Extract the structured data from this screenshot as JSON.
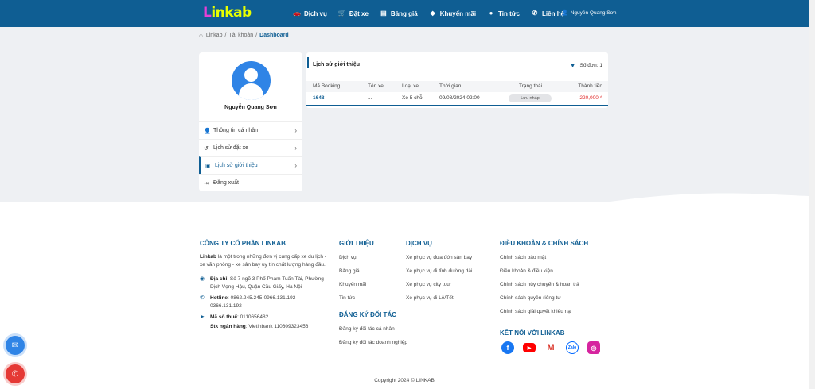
{
  "header": {
    "logo_text_1": "L",
    "logo_text_2": "inkab",
    "nav": [
      {
        "label": "Dịch vụ",
        "icon": "car-icon"
      },
      {
        "label": "Đặt xe",
        "icon": "cart-icon"
      },
      {
        "label": "Bảng giá",
        "icon": "price-table-icon"
      },
      {
        "label": "Khuyến mãi",
        "icon": "tag-icon"
      },
      {
        "label": "Tin tức",
        "icon": "chat-icon"
      },
      {
        "label": "Liên hệ",
        "icon": "phone-icon"
      }
    ],
    "user_name": "Nguyễn Quang Sơn"
  },
  "breadcrumb": {
    "items": [
      "Linkab",
      "Tài khoản"
    ],
    "current": "Dashboard"
  },
  "profile": {
    "name": "Nguyễn Quang Sơn",
    "menu": [
      {
        "label": "Thông tin cá nhân",
        "icon": "user-icon"
      },
      {
        "label": "Lịch sử đặt xe",
        "icon": "history-icon"
      },
      {
        "label": "Lịch sử giới thiệu",
        "icon": "clipboard-icon"
      },
      {
        "label": "Đăng xuất",
        "icon": "logout-icon"
      }
    ]
  },
  "referral": {
    "title": "Lịch sử giới thiệu",
    "count_label": "Số đơn: 1",
    "columns": [
      "Mã Booking",
      "Tên xe",
      "Loại xe",
      "Thời gian",
      "Trạng thái",
      "Thành tiền"
    ],
    "rows": [
      {
        "booking": "1648",
        "car_name": "...",
        "car_type": "Xe 5 chỗ",
        "time": "09/08/2024 02:00",
        "status": "Lưu nháp",
        "amount": "220,000 ₫"
      }
    ]
  },
  "footer": {
    "company_title": "CÔNG TY CỔ PHẦN LINKAB",
    "company_brand": "Linkab",
    "company_desc": " là một trong những đơn vị cung cấp xe du lịch - xe văn phòng - xe sân bay uy tín chất lượng hàng đầu.",
    "address_label": "Địa chỉ",
    "address": ": Số 7 ngõ 3 Phố Phạm Tuấn Tài, Phường Dịch Vọng Hậu, Quận Cầu Giấy, Hà Nội",
    "hotline_label": "Hotline",
    "hotline": ": 0862.245.245-0966.131.192-0366.131.192",
    "tax_label": "Mã số thuế",
    "tax": ": 0110656482",
    "bank_label": "Stk ngân hàng",
    "bank": ": Vietinbank 110609323456",
    "intro_title": "GIỚI THIỆU",
    "intro_links": [
      "Dịch vụ",
      "Bảng giá",
      "Khuyến mãi",
      "Tin tức"
    ],
    "partner_title": "ĐĂNG KÝ ĐỐI TÁC",
    "partner_links": [
      "Đăng ký đối tác cá nhân",
      "Đăng ký đối tác doanh nghiệp"
    ],
    "service_title": "DỊCH VỤ",
    "service_links": [
      "Xe phục vụ đưa đón sân bay",
      "Xe phục vụ đi tỉnh đường dài",
      "Xe phục vụ city tour",
      "Xe phục vụ đi Lễ/Tết"
    ],
    "policy_title": "ĐIỀU KHOẢN & CHÍNH SÁCH",
    "policy_links": [
      "Chính sách bảo mật",
      "Điều khoản & điều kiện",
      "Chính sách hủy chuyến & hoàn trả",
      "Chính sách quyền riêng tư",
      "Chính sách giải quyết khiếu nại"
    ],
    "social_title": "KẾT NỐI VỚI LINKAB",
    "zalo_label": "Zalo",
    "copyright": "Copyright 2024 © LINKAB"
  }
}
